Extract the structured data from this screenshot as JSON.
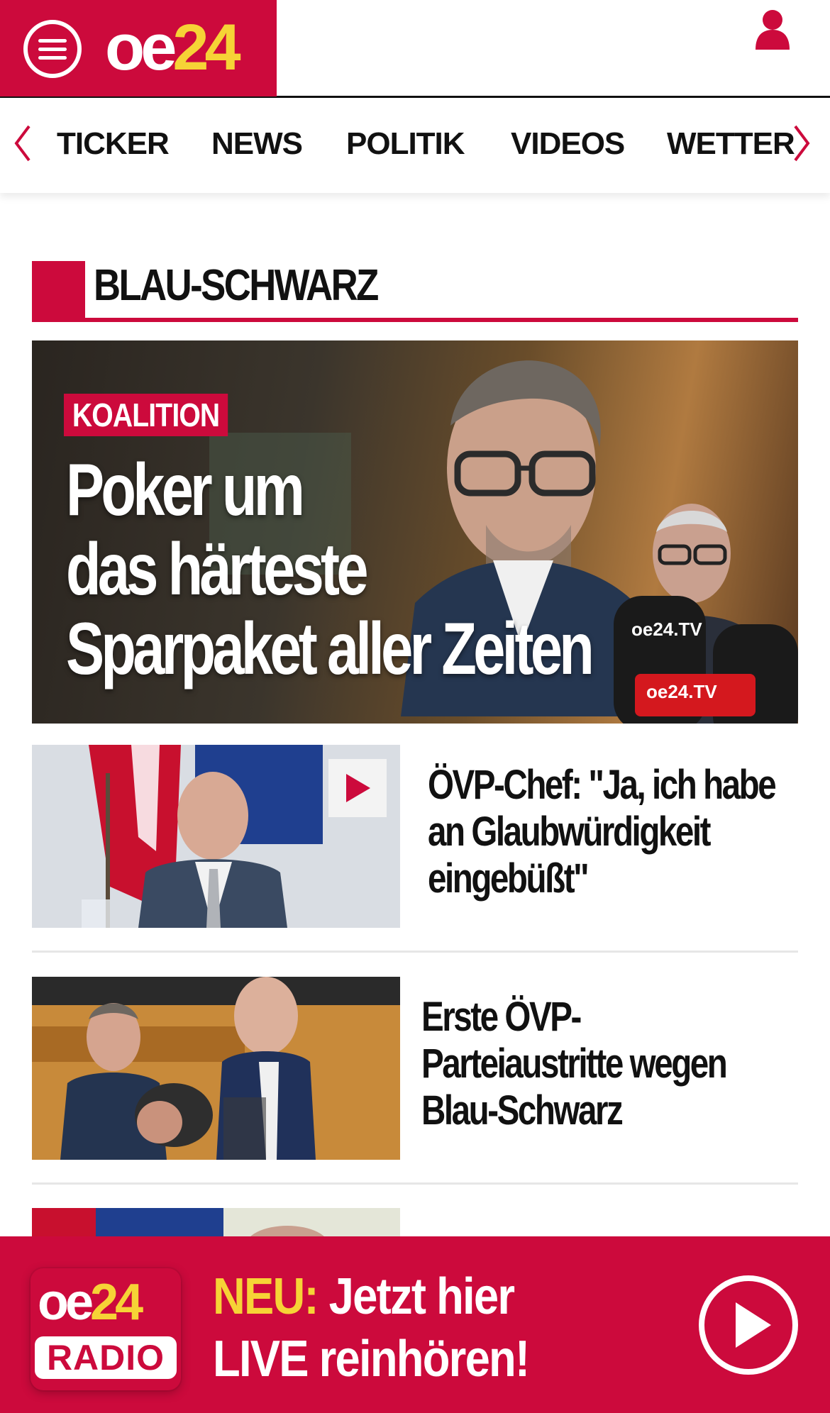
{
  "header": {
    "logo_oe": "oe",
    "logo_num": "24",
    "menu_icon": "hamburger-menu-icon",
    "user_icon": "user-account-icon"
  },
  "nav": {
    "items": [
      {
        "label": "TICKER"
      },
      {
        "label": "NEWS"
      },
      {
        "label": "POLITIK"
      },
      {
        "label": "VIDEOS"
      },
      {
        "label": "WETTER"
      }
    ],
    "prev_icon": "chevron-left-icon",
    "next_icon": "chevron-right-icon"
  },
  "section": {
    "title": "BLAU-SCHWARZ"
  },
  "hero": {
    "tag": "KOALITION",
    "headline_line1": "Poker um",
    "headline_line2": "das härteste",
    "headline_line3": "Sparpaket aller Zeiten",
    "mic_label_1": "oe24.TV",
    "mic_label_2": "oe24.TV"
  },
  "articles": [
    {
      "title_line1": "ÖVP-Chef: \"Ja, ich habe",
      "title_line2": "an Glaubwürdigkeit",
      "title_line3": "eingebüßt\"",
      "has_video": true
    },
    {
      "title_line1": "Erste ÖVP-",
      "title_line2": "Parteiaustritte wegen",
      "title_line3": "Blau-Schwarz",
      "has_video": false
    }
  ],
  "radio_banner": {
    "badge_oe": "oe",
    "badge_num": "24",
    "badge_radio": "RADIO",
    "neu": "NEU:",
    "line1_rest": " Jetzt hier",
    "line2": "LIVE reinhören!",
    "play_icon": "play-circle-icon"
  },
  "colors": {
    "brand_red": "#cc0a3c",
    "brand_yellow": "#f6d336"
  }
}
